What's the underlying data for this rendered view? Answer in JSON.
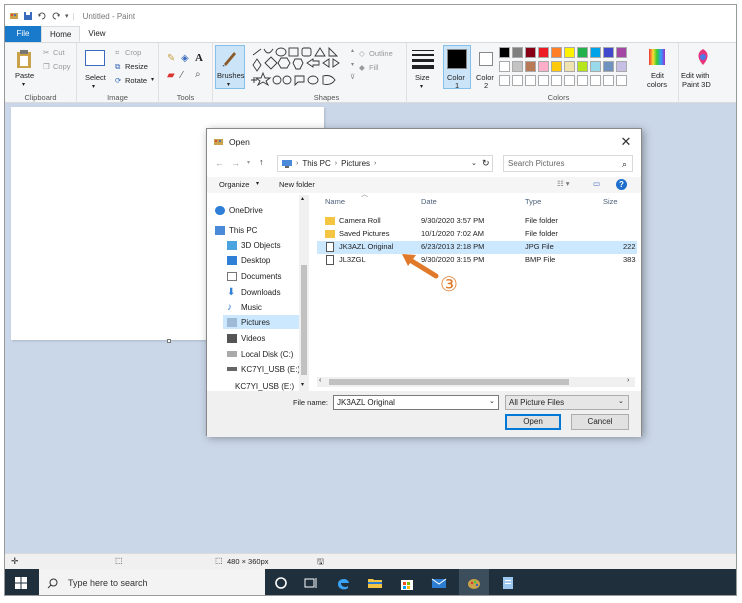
{
  "window": {
    "title": "Untitled - Paint"
  },
  "tabs": {
    "file": "File",
    "home": "Home",
    "view": "View"
  },
  "ribbon": {
    "clipboard": {
      "paste": "Paste",
      "cut": "Cut",
      "copy": "Copy",
      "label": "Clipboard"
    },
    "image": {
      "select": "Select",
      "crop": "Crop",
      "resize": "Resize",
      "rotate": "Rotate",
      "label": "Image"
    },
    "tools": {
      "label": "Tools"
    },
    "brushes": {
      "label": "Brushes"
    },
    "shapes": {
      "outline": "Outline",
      "fill": "Fill",
      "label": "Shapes"
    },
    "size": {
      "label": "Size"
    },
    "colors": {
      "color1": "Color\n1",
      "color1_a": "Color",
      "color1_b": "1",
      "color2_a": "Color",
      "color2_b": "2",
      "edit_a": "Edit",
      "edit_b": "colors",
      "label": "Colors"
    },
    "paint3d": {
      "a": "Edit with",
      "b": "Paint 3D"
    },
    "palette_row1": [
      "#000000",
      "#7f7f7f",
      "#880015",
      "#ed1c24",
      "#ff7f27",
      "#fff200",
      "#22b14c",
      "#00a2e8",
      "#3f48cc",
      "#a349a4"
    ],
    "palette_row2": [
      "#ffffff",
      "#c3c3c3",
      "#b97a57",
      "#ffaec9",
      "#ffc90e",
      "#efe4b0",
      "#b5e61d",
      "#99d9ea",
      "#7092be",
      "#c8bfe7"
    ]
  },
  "status": {
    "size": "480 × 360px"
  },
  "taskbar": {
    "search_placeholder": "Type here to search"
  },
  "dialog": {
    "title": "Open",
    "path": [
      "This PC",
      "Pictures"
    ],
    "search_placeholder": "Search Pictures",
    "organize": "Organize",
    "new_folder": "New folder",
    "nav": [
      "OneDrive",
      "This PC",
      "3D Objects",
      "Desktop",
      "Documents",
      "Downloads",
      "Music",
      "Pictures",
      "Videos",
      "Local Disk (C:)",
      "KC7YI_USB (E:)",
      "KC7YI_USB (E:)"
    ],
    "columns": {
      "name": "Name",
      "date": "Date",
      "type": "Type",
      "size": "Size"
    },
    "files": [
      {
        "name": "Camera Roll",
        "date": "9/30/2020 3:57 PM",
        "type": "File folder",
        "size": ""
      },
      {
        "name": "Saved Pictures",
        "date": "10/1/2020 7:02 AM",
        "type": "File folder",
        "size": ""
      },
      {
        "name": "JK3AZL Original",
        "date": "6/23/2013 2:18 PM",
        "type": "JPG File",
        "size": "222"
      },
      {
        "name": "JL3ZGL",
        "date": "9/30/2020 3:15 PM",
        "type": "BMP File",
        "size": "383"
      }
    ],
    "filename_label": "File name:",
    "filename_value": "JK3AZL Original",
    "filter": "All Picture Files",
    "open": "Open",
    "cancel": "Cancel"
  },
  "annotation": {
    "marker": "③"
  },
  "colors": {
    "accent": "#1979ca",
    "selection": "#cce8ff",
    "arrow": "#e07a2a",
    "workspace": "#cad7e8"
  }
}
